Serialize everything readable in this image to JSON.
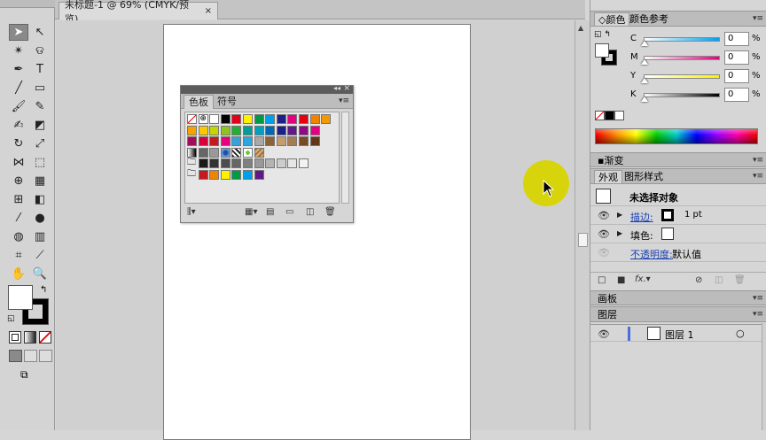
{
  "document_tab": {
    "title": "未标题-1 @ 69% (CMYK/预览)",
    "close": "×"
  },
  "swatches_panel": {
    "collapse": "◂◂",
    "close": "×",
    "tabs": [
      "色板",
      "符号"
    ],
    "menu": "▾≡",
    "rows": [
      [
        "none",
        "registration",
        "#ffffff",
        "#000000",
        "#e2001a",
        "#fff100",
        "#009944",
        "#00a0e9",
        "#1d2088",
        "#e4007f",
        "#e60012",
        "#f08300",
        "#f39800"
      ],
      [
        "#f5a200",
        "#fcc800",
        "#c3d600",
        "#8fc31f",
        "#22ac38",
        "#009e96",
        "#00a0c1",
        "#0068b7",
        "#1d2088",
        "#601986",
        "#920783",
        "#e4007f"
      ],
      [
        "#a40b5d",
        "#d7003a",
        "#c9171e",
        "#e6007e",
        "#38a1db",
        "#2ca6e0",
        "#a8a8a8",
        "#8c6239",
        "#c69c6d",
        "#a67c52",
        "#754c24",
        "#603813"
      ],
      [
        "gradient",
        "#666666",
        "#999999",
        "patternblue",
        "pattern",
        "pattern2",
        "pattern3"
      ],
      [
        "folder",
        "#1a1a1a",
        "#333333",
        "#4d4d4d",
        "#666666",
        "#808080",
        "#999999",
        "#b3b3b3",
        "#cccccc",
        "#e6e6e6",
        "#f2f2f2"
      ],
      [
        "folder",
        "#c9171e",
        "#f08300",
        "#fff100",
        "#009944",
        "#00a0e9",
        "#601986"
      ]
    ],
    "footer_icons": [
      "library-icon",
      "swatch-kind-icon",
      "swatch-options-icon",
      "new-group-icon",
      "new-swatch-icon",
      "delete-icon"
    ]
  },
  "color_panel": {
    "tabs": [
      "颜色",
      "颜色参考"
    ],
    "channels": [
      {
        "label": "C",
        "value": "0",
        "unit": "%",
        "gradient": "#00a0e9"
      },
      {
        "label": "M",
        "value": "0",
        "unit": "%",
        "gradient": "#e4007f"
      },
      {
        "label": "Y",
        "value": "0",
        "unit": "%",
        "gradient": "#fff100"
      },
      {
        "label": "K",
        "value": "0",
        "unit": "%",
        "gradient": "#000000"
      }
    ]
  },
  "gradient_panel": {
    "title": "渐变"
  },
  "appearance_panel": {
    "tabs": [
      "外观",
      "图形样式"
    ],
    "header": "未选择对象",
    "stroke_label": "描边:",
    "stroke_weight": "1 pt",
    "fill_label": "填色:",
    "opacity_label": "不透明度:",
    "opacity_value": "默认值"
  },
  "artboards_panel": {
    "title": "画板"
  },
  "layers_panel": {
    "title": "图层",
    "layer_name": "图层 1"
  }
}
